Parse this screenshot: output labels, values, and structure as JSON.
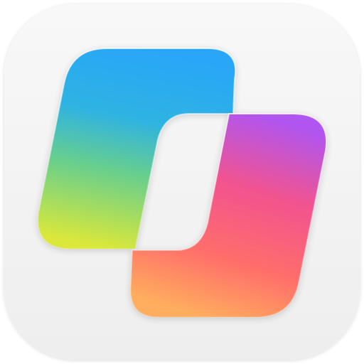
{
  "icon": {
    "name": "app-icon",
    "shape": "rounded-square",
    "background_color": "#f3f3f3",
    "glyph": "two-interlocking-slanted-tiles"
  },
  "tiles": {
    "left": {
      "name": "left-slanted-tile",
      "gradient": [
        "#2aa8f7",
        "#25b6e6",
        "#5bd08a",
        "#d9e83a"
      ]
    },
    "right": {
      "name": "right-slanted-tile",
      "gradient": [
        "#b257f0",
        "#f0548e",
        "#ff6e66",
        "#ffa85f"
      ]
    }
  }
}
